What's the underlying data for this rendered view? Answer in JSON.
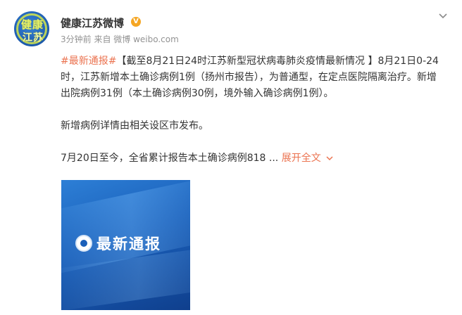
{
  "account": {
    "name": "健康江苏微博",
    "verified_badge": "V",
    "avatar_line1": "健康",
    "avatar_line2": "江苏"
  },
  "post": {
    "meta": "3分钟前 来自 微博 weibo.com",
    "tag": "#最新通报#",
    "headline_text": "【截至8月21日24时江苏新型冠状病毒肺炎疫情最新情况 】8月21日0-24时，江苏新增本土确诊病例1例（扬州市报告），为普通型，在定点医院隔离治疗。新增出院病例31例（本土确诊病例30例，境外输入确诊病例1例）。",
    "paragraph2": "新增病例详情由相关设区市发布。",
    "paragraph3": "7月20日至今，全省累计报告本土确诊病例818 ...",
    "expand_label": "展开全文",
    "image_title": "最新通报"
  },
  "icons": {
    "menu": "chevron-down-icon",
    "expand": "chevron-down-icon",
    "emblem": "emblem-icon"
  },
  "colors": {
    "accent": "#eb7350",
    "badge": "#f5a623",
    "image_blue": "#1a5fb9"
  }
}
